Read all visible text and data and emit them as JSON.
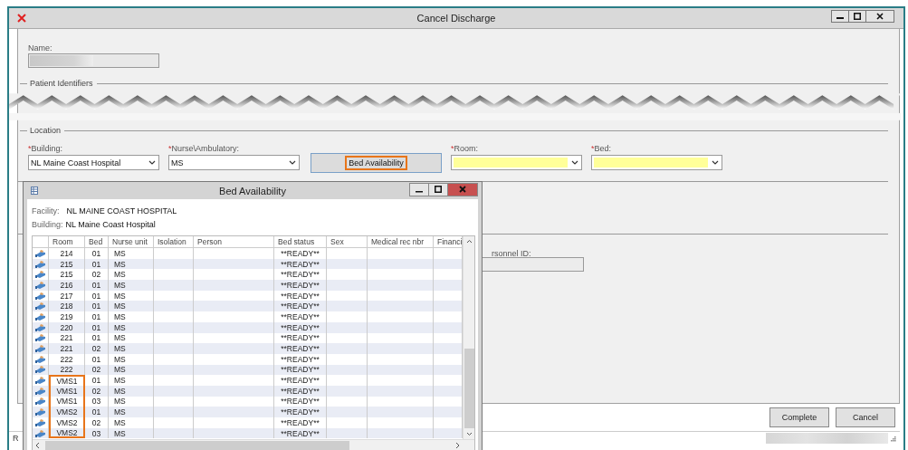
{
  "window": {
    "title": "Cancel Discharge"
  },
  "name": {
    "label": "Name:"
  },
  "patient_identifiers": {
    "title": "Patient Identifiers"
  },
  "location": {
    "title": "Location",
    "items": [
      {
        "kind": "dropdown",
        "marker": "*",
        "label": "Building:",
        "value": "NL Maine Coast Hospital",
        "highlighted": false
      },
      {
        "kind": "dropdown",
        "marker": "*",
        "label": "Nurse\\Ambulatory:",
        "value": "MS",
        "highlighted": false
      },
      {
        "kind": "button",
        "label": "Bed Availability",
        "highlighted": true
      },
      {
        "kind": "dropdown",
        "marker": "*",
        "label": "Room:",
        "highlighted": true
      },
      {
        "kind": "dropdown",
        "marker": "*",
        "label": "Bed:",
        "highlighted": true
      }
    ]
  },
  "personnel": {
    "label": "rsonnel ID:"
  },
  "buttons": [
    {
      "label": "Complete"
    },
    {
      "label": "Cancel"
    }
  ],
  "status_bar": {
    "text": "R"
  },
  "dialog": {
    "title": "Bed Availability",
    "facility": {
      "label": "Facility:",
      "value": "NL MAINE COAST HOSPITAL"
    },
    "building": {
      "label": "Building:",
      "value": "NL Maine Coast Hospital"
    },
    "table": {
      "columns": [
        "Room",
        "Bed",
        "Nurse unit",
        "Isolation",
        "Person",
        "Bed status",
        "Sex",
        "Medical rec nbr",
        "Financi"
      ],
      "rows": [
        {
          "room": "214",
          "bed": "01",
          "nurse_unit": "MS",
          "status": "**READY**",
          "highlighted": false
        },
        {
          "room": "215",
          "bed": "01",
          "nurse_unit": "MS",
          "status": "**READY**",
          "highlighted": false
        },
        {
          "room": "215",
          "bed": "02",
          "nurse_unit": "MS",
          "status": "**READY**",
          "highlighted": false
        },
        {
          "room": "216",
          "bed": "01",
          "nurse_unit": "MS",
          "status": "**READY**",
          "highlighted": false
        },
        {
          "room": "217",
          "bed": "01",
          "nurse_unit": "MS",
          "status": "**READY**",
          "highlighted": false
        },
        {
          "room": "218",
          "bed": "01",
          "nurse_unit": "MS",
          "status": "**READY**",
          "highlighted": false
        },
        {
          "room": "219",
          "bed": "01",
          "nurse_unit": "MS",
          "status": "**READY**",
          "highlighted": false
        },
        {
          "room": "220",
          "bed": "01",
          "nurse_unit": "MS",
          "status": "**READY**",
          "highlighted": false
        },
        {
          "room": "221",
          "bed": "01",
          "nurse_unit": "MS",
          "status": "**READY**",
          "highlighted": false
        },
        {
          "room": "221",
          "bed": "02",
          "nurse_unit": "MS",
          "status": "**READY**",
          "highlighted": false
        },
        {
          "room": "222",
          "bed": "01",
          "nurse_unit": "MS",
          "status": "**READY**",
          "highlighted": false
        },
        {
          "room": "222",
          "bed": "02",
          "nurse_unit": "MS",
          "status": "**READY**",
          "highlighted": false
        },
        {
          "room": "VMS1",
          "bed": "01",
          "nurse_unit": "MS",
          "status": "**READY**",
          "highlighted": true
        },
        {
          "room": "VMS1",
          "bed": "02",
          "nurse_unit": "MS",
          "status": "**READY**",
          "highlighted": true
        },
        {
          "room": "VMS1",
          "bed": "03",
          "nurse_unit": "MS",
          "status": "**READY**",
          "highlighted": true
        },
        {
          "room": "VMS2",
          "bed": "01",
          "nurse_unit": "MS",
          "status": "**READY**",
          "highlighted": true
        },
        {
          "room": "VMS2",
          "bed": "02",
          "nurse_unit": "MS",
          "status": "**READY**",
          "highlighted": true
        },
        {
          "room": "VMS2",
          "bed": "03",
          "nurse_unit": "MS",
          "status": "**READY**",
          "highlighted": true
        }
      ]
    }
  }
}
